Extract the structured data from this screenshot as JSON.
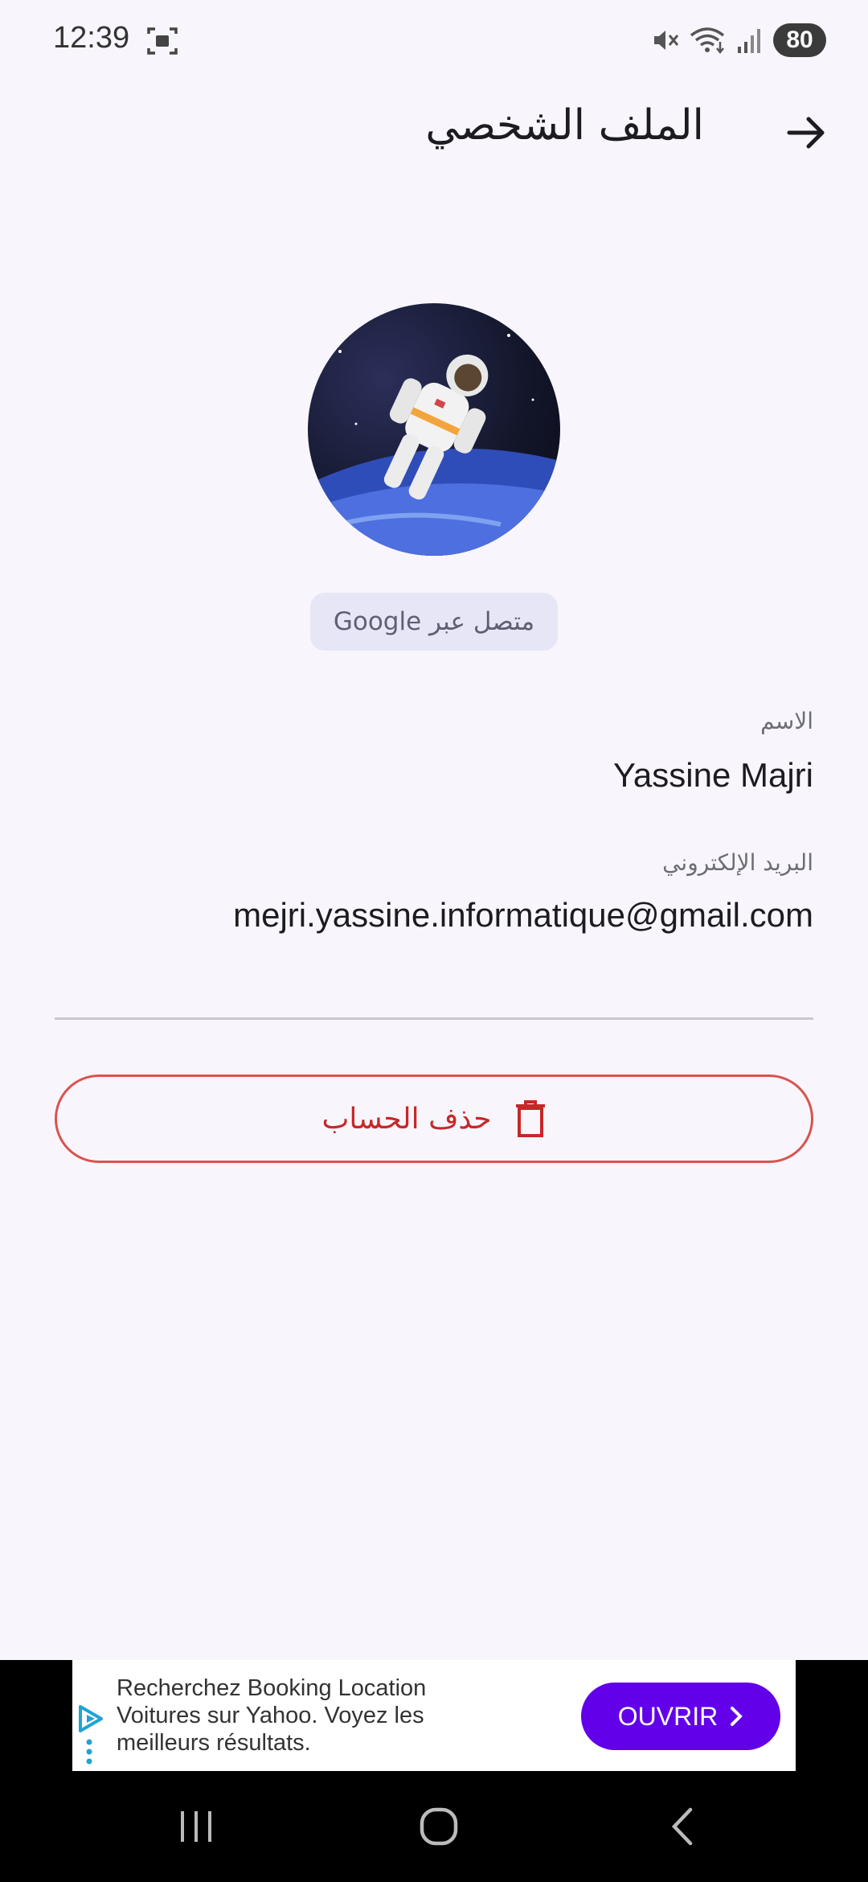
{
  "status_bar": {
    "time": "12:39",
    "battery": "80",
    "icons": [
      "screenshot-icon",
      "mute-icon",
      "wifi-icon",
      "signal-icon"
    ]
  },
  "app_bar": {
    "title": "الملف الشخصي",
    "back_icon": "arrow-right-icon"
  },
  "profile": {
    "avatar": "astronaut-avatar",
    "provider_badge": "متصل عبر Google",
    "name_label": "الاسم",
    "name_value": "Yassine Majri",
    "email_label": "البريد الإلكتروني",
    "email_value": "mejri.yassine.informatique@gmail.com"
  },
  "actions": {
    "delete_label": "حذف الحساب",
    "delete_icon": "trash-icon"
  },
  "ad": {
    "text": "Recherchez Booking Location Voitures sur Yahoo. Voyez les meilleurs résultats.",
    "button_label": "OUVRIR"
  },
  "nav_bar": {
    "items": [
      "recents-icon",
      "home-icon",
      "back-icon"
    ]
  },
  "colors": {
    "background": "#f8f6fc",
    "danger": "#c62828",
    "ad_button": "#6200ea",
    "badge_bg": "#e6e6f6"
  }
}
